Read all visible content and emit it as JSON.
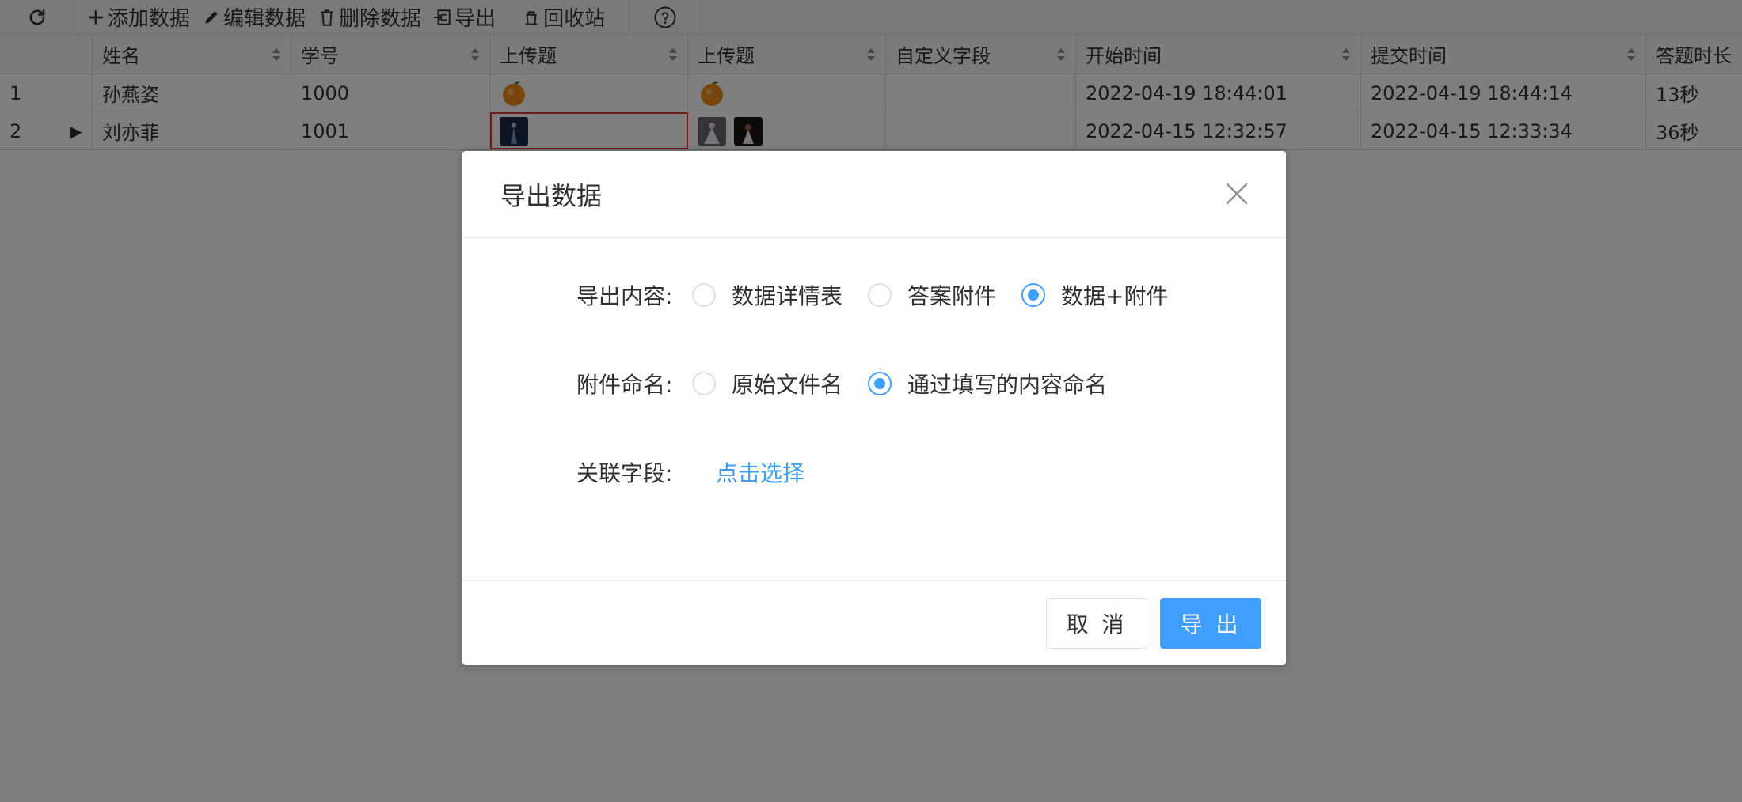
{
  "toolbar": {
    "add": "添加数据",
    "edit": "编辑数据",
    "delete": "删除数据",
    "export": "导出",
    "recycle": "回收站"
  },
  "table": {
    "columns": [
      "姓名",
      "学号",
      "上传题",
      "上传题",
      "自定义字段",
      "开始时间",
      "提交时间",
      "答题时长"
    ],
    "rows": [
      {
        "num": "1",
        "name": "孙燕姿",
        "id": "1000",
        "custom": "",
        "start": "2022-04-19 18:44:01",
        "submit": "2022-04-19 18:44:14",
        "duration": "13秒"
      },
      {
        "num": "2",
        "marker": "▶",
        "name": "刘亦菲",
        "id": "1001",
        "custom": "",
        "start": "2022-04-15 12:32:57",
        "submit": "2022-04-15 12:33:34",
        "duration": "36秒"
      }
    ]
  },
  "dialog": {
    "title": "导出数据",
    "content": {
      "label": "导出内容:",
      "options": [
        "数据详情表",
        "答案附件",
        "数据+附件"
      ],
      "selected": "数据+附件"
    },
    "naming": {
      "label": "附件命名:",
      "options": [
        "原始文件名",
        "通过填写的内容命名"
      ],
      "selected": "通过填写的内容命名"
    },
    "field": {
      "label": "关联字段:",
      "link": "点击选择"
    },
    "cancel": "取 消",
    "confirm": "导 出"
  },
  "colors": {
    "primary": "#409eff",
    "overlay": "rgba(0,0,0,0.5)",
    "selected_cell_border": "#e53935"
  }
}
